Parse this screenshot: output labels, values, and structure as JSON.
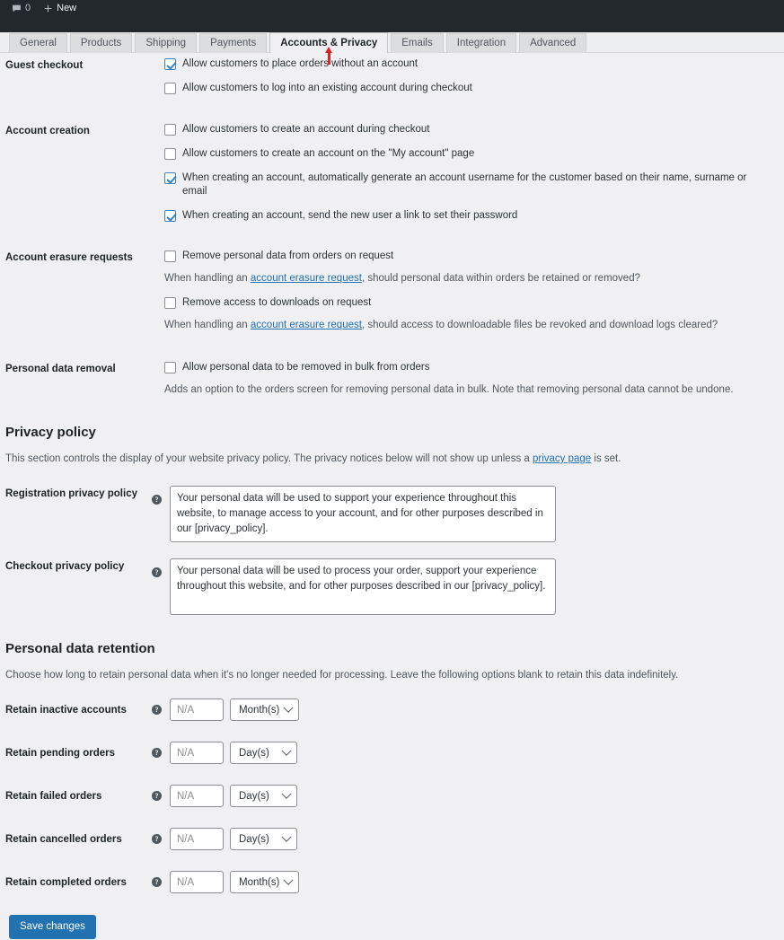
{
  "adminbar": {
    "comments_icon": "comment-bubble-icon",
    "comments_count": "0",
    "new_icon": "plus-icon",
    "new_label": "New"
  },
  "tabs": [
    {
      "label": "General",
      "active": false
    },
    {
      "label": "Products",
      "active": false
    },
    {
      "label": "Shipping",
      "active": false
    },
    {
      "label": "Payments",
      "active": false
    },
    {
      "label": "Accounts & Privacy",
      "active": true
    },
    {
      "label": "Emails",
      "active": false
    },
    {
      "label": "Integration",
      "active": false
    },
    {
      "label": "Advanced",
      "active": false
    }
  ],
  "pointer": {
    "name": "red-up-arrow-annotation",
    "color": "#e32121",
    "target_tab": "Accounts & Privacy"
  },
  "settings": {
    "guest_checkout": {
      "label": "Guest checkout",
      "options": [
        {
          "label": "Allow customers to place orders without an account",
          "checked": true
        },
        {
          "label": "Allow customers to log into an existing account during checkout",
          "checked": false
        }
      ]
    },
    "account_creation": {
      "label": "Account creation",
      "options": [
        {
          "label": "Allow customers to create an account during checkout",
          "checked": false
        },
        {
          "label": "Allow customers to create an account on the \"My account\" page",
          "checked": false
        },
        {
          "label": "When creating an account, automatically generate an account username for the customer based on their name, surname or email",
          "checked": true
        },
        {
          "label": "When creating an account, send the new user a link to set their password",
          "checked": true
        }
      ]
    },
    "account_erasure": {
      "label": "Account erasure requests",
      "option1_label": "Remove personal data from orders on request",
      "option1_checked": false,
      "desc1_pre": "When handling an ",
      "desc1_link": "account erasure request",
      "desc1_post": ", should personal data within orders be retained or removed?",
      "option2_label": "Remove access to downloads on request",
      "option2_checked": false,
      "desc2_pre": "When handling an ",
      "desc2_link": "account erasure request",
      "desc2_post": ", should access to downloadable files be revoked and download logs cleared?"
    },
    "personal_data_removal": {
      "label": "Personal data removal",
      "option_label": "Allow personal data to be removed in bulk from orders",
      "option_checked": false,
      "desc": "Adds an option to the orders screen for removing personal data in bulk. Note that removing personal data cannot be undone."
    }
  },
  "privacy_policy": {
    "heading": "Privacy policy",
    "desc_pre": "This section controls the display of your website privacy policy. The privacy notices below will not show up unless a ",
    "desc_link": "privacy page",
    "desc_post": " is set.",
    "registration": {
      "label": "Registration privacy policy",
      "help_icon": "help-tip-icon",
      "value": "Your personal data will be used to support your experience throughout this website, to manage access to your account, and for other purposes described in our [privacy_policy]."
    },
    "checkout": {
      "label": "Checkout privacy policy",
      "help_icon": "help-tip-icon",
      "value": "Your personal data will be used to process your order, support your experience throughout this website, and for other purposes described in our [privacy_policy]."
    }
  },
  "retention": {
    "heading": "Personal data retention",
    "desc": "Choose how long to retain personal data when it's no longer needed for processing. Leave the following options blank to retain this data indefinitely.",
    "placeholder": "N/A",
    "rows": [
      {
        "label": "Retain inactive accounts",
        "value": "",
        "unit": "Month(s)"
      },
      {
        "label": "Retain pending orders",
        "value": "",
        "unit": "Day(s)"
      },
      {
        "label": "Retain failed orders",
        "value": "",
        "unit": "Day(s)"
      },
      {
        "label": "Retain cancelled orders",
        "value": "",
        "unit": "Day(s)"
      },
      {
        "label": "Retain completed orders",
        "value": "",
        "unit": "Month(s)"
      }
    ]
  },
  "footer": {
    "save_label": "Save changes"
  },
  "colors": {
    "accent": "#2271b1",
    "link": "#2271b1",
    "adminbar_bg": "#23282d",
    "page_bg": "#f0eff1",
    "pointer": "#e32121"
  }
}
